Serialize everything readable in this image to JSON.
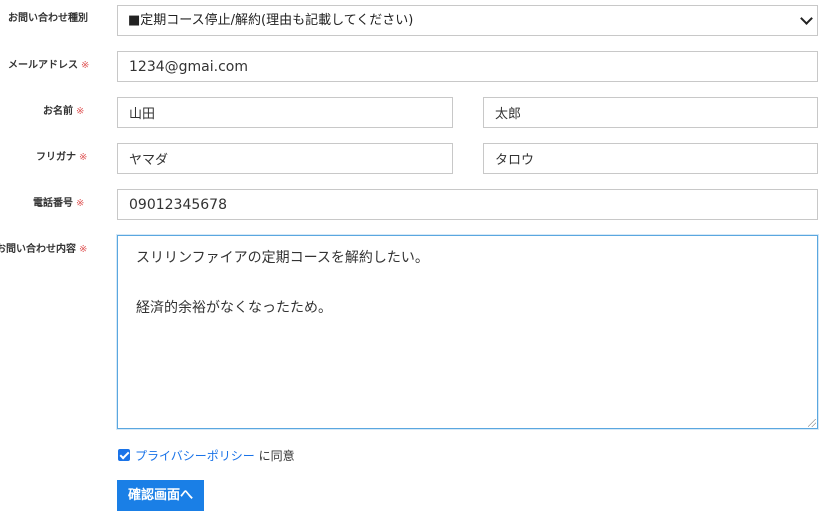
{
  "form": {
    "inquiry_type": {
      "label": "お問い合わせ種別",
      "selected": "■定期コース停止/解約(理由も記載してください)"
    },
    "email": {
      "label": "メールアドレス",
      "required_mark": "※",
      "value": "1234@gmai.com"
    },
    "name": {
      "label": "お名前",
      "required_mark": "※",
      "last": "山田",
      "first": "太郎"
    },
    "furigana": {
      "label": "フリガナ",
      "required_mark": "※",
      "last": "ヤマダ",
      "first": "タロウ"
    },
    "phone": {
      "label": "電話番号",
      "required_mark": "※",
      "value": "09012345678"
    },
    "message": {
      "label": "お問い合わせ内容",
      "required_mark": "※",
      "value": "スリリンファイアの定期コースを解約したい。\n\n経済的余裕がなくなったため。"
    },
    "privacy": {
      "checked": true,
      "link_text": "プライバシーポリシー",
      "suffix": " に同意"
    },
    "submit_label": "確認画面へ"
  },
  "colors": {
    "accent": "#1a7fe6",
    "required": "#e05a5a",
    "focus_border": "#5aa7e0"
  }
}
